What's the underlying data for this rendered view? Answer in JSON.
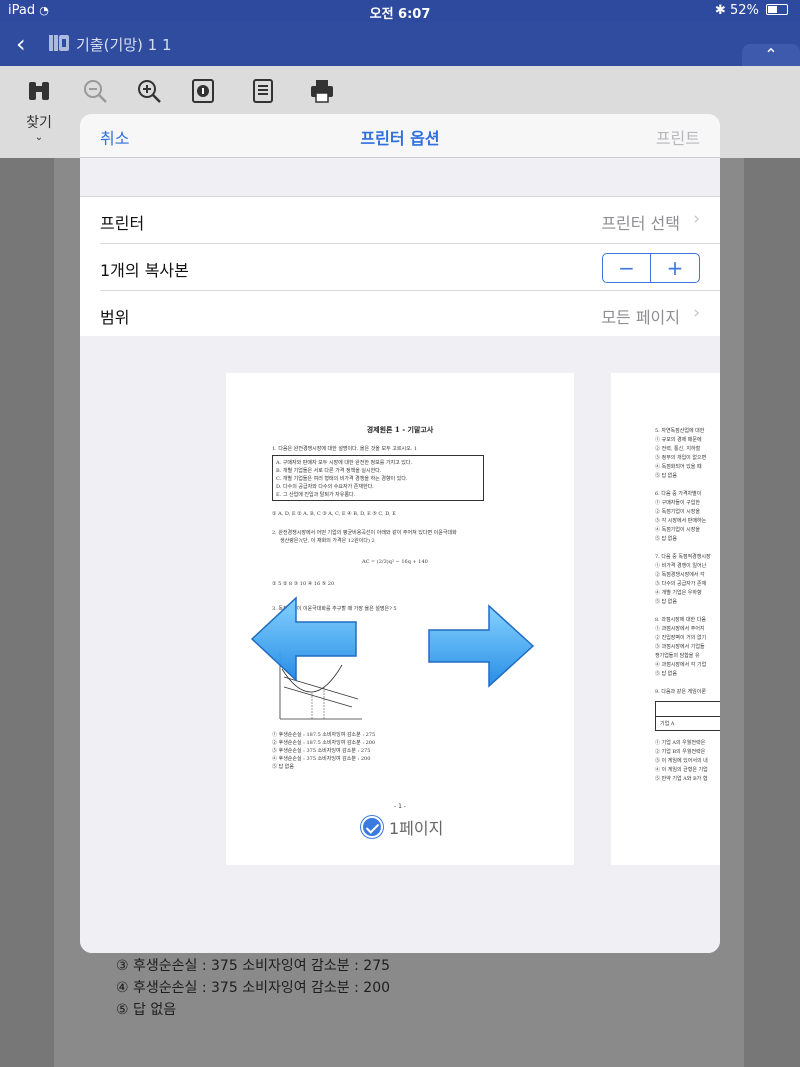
{
  "status": {
    "device": "iPad",
    "time": "오전 6:07",
    "battery": "52%",
    "battery_level": 0.52
  },
  "nav": {
    "title": "기출(기망) 1 1"
  },
  "toolbar": {
    "find_label": "찾기"
  },
  "modal": {
    "cancel": "취소",
    "title": "프린터 옵션",
    "print": "프린트",
    "rows": {
      "printer": {
        "label": "프린터",
        "value": "프린터 선택"
      },
      "copies": {
        "label": "1개의 복사본",
        "minus": "−",
        "plus": "+"
      },
      "range": {
        "label": "범위",
        "value": "모든 페이지"
      }
    },
    "preview": {
      "page_label": "1페이지",
      "thumb_title": "경제원론 1 - 기말고사",
      "thumb_pagenum": "- 1 -",
      "thumb_q1": "1. 다음은 완전경쟁시장에 대한 설명이다. 옳은 것을 모두 고르시오. 1",
      "thumb_box": [
        "A. 구매자와 판매자 모두 시장에 대한 완전한 정보를 가지고 있다.",
        "B. 개별 기업들은 서로 다른 가격 정책을 실시한다.",
        "C. 개별 기업들은 여러 형태의 비가격 경쟁을 하는 경향이 있다.",
        "D. 다수의 공급자와 다수의 수요자가 존재한다.",
        "E. 그 산업에 진입과 탈퇴가 자유롭다."
      ],
      "thumb_opts1": "① A, D, E      ② A, B, C      ③ A, C, E      ④ B, D, E      ⑤ C, D, E",
      "thumb_q2": "2. 완전경쟁시장에서 어떤 기업의 평균비용곡선이 아래와 같이 주어져 있다면 이윤극대화",
      "thumb_q2b": "생산량은?(단, 이 재화의 가격은 12원이다) 2",
      "thumb_formula": "AC = (2/3)q² − 16q + 140",
      "thumb_opts2": "① 5          ② 8          ③ 10          ④ 16          ⑤ 20",
      "thumb_q3": "3. 독점기업이 이윤극대화를 추구할 때 가장 옳은 설명은? 5",
      "thumb_lines": [
        "① 후생순손실 : 187.5   소비자잉여 감소분 : 275",
        "② 후생순손실 : 187.5   소비자잉여 감소분 : 200",
        "③ 후생순손실 : 375   소비자잉여 감소분 : 275",
        "④ 후생순손실 : 375   소비자잉여 감소분 : 200",
        "⑤ 답 없음"
      ],
      "p2_lines": [
        "5. 자연독점산업에 대한",
        "① 규모의 경제 때문에",
        "② 전력, 통신, 지하철",
        "③ 정부의 개입이 없으면",
        "④ 독점화되어 있을 때",
        "⑤ 답 없음",
        "",
        "6. 다음 중 가격차별이",
        "① 구매자들이 구입한",
        "② 독점기업이 시장을",
        "③ 각 시장에서 판매하는",
        "④ 독점기업이 시장을",
        "⑤ 답 없음",
        "",
        "7. 다음 중 독점적경쟁시장",
        "① 비가격 경쟁이 일어난",
        "② 독점경쟁시장에서 각",
        "③ 다수의 공급자가 존재",
        "④ 개별 기업은 우하향",
        "⑤ 답 없음",
        "",
        "8. 과점시장에 대한 다음",
        "① 과점시장에서 주어지",
        "② 진입장벽이 거의 없기",
        "③ 과점시장에서 기업들",
        "  쟁기업들의 담합을 유",
        "④ 과점시장에서 각 기업",
        "⑤ 답 없음",
        "",
        "9. 다음과 같은 게임이론"
      ],
      "p2_lines_b": [
        "① 기업 A의 우월전략은",
        "② 기업 B의 우월전략은",
        "③ 이 게임에 있어서의 내",
        "④ 이 게임의 균형은 기업",
        "⑤ 만약 기업 A와 B가 협"
      ],
      "p2_table_label": "기업 A"
    }
  },
  "background_doc": {
    "lines": [
      "③ 후생순손실 : 375   소비자잉여 감소분 : 275",
      "④ 후생순손실 : 375   소비자잉여 감소분 : 200",
      "⑤ 답 없음"
    ]
  }
}
